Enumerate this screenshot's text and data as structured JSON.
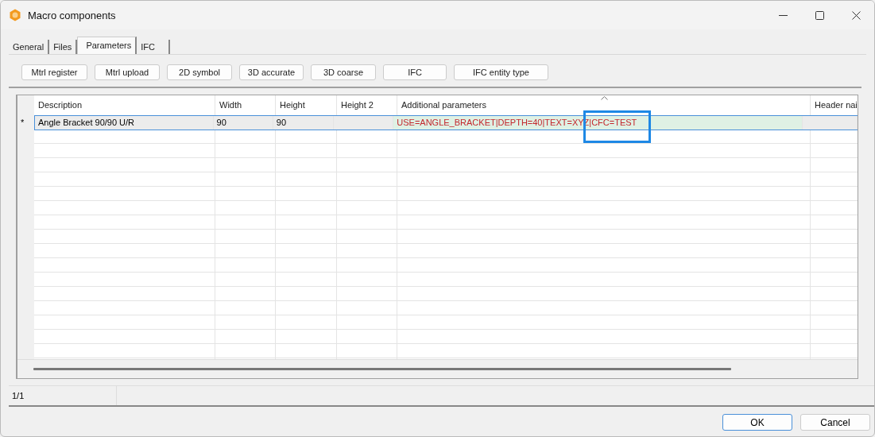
{
  "window": {
    "title": "Macro components"
  },
  "tabs": [
    {
      "label": "General",
      "selected": false
    },
    {
      "label": "Files",
      "selected": false
    },
    {
      "label": "Parameters",
      "selected": true
    },
    {
      "label": "IFC",
      "selected": false
    }
  ],
  "toolbar": [
    "Mtrl register",
    "Mtrl upload",
    "2D symbol",
    "3D accurate",
    "3D coarse",
    "IFC",
    "IFC entity type"
  ],
  "table": {
    "columns": [
      {
        "label": "Description",
        "sorted": false
      },
      {
        "label": "Width",
        "sorted": false
      },
      {
        "label": "Height",
        "sorted": false
      },
      {
        "label": "Height 2",
        "sorted": false
      },
      {
        "label": "Additional parameters",
        "sorted": true
      },
      {
        "label": "Header nai",
        "sorted": false
      }
    ],
    "rows": [
      {
        "marker": "*",
        "selected": true,
        "cells": [
          "Angle Bracket 90/90 U/R",
          "90",
          "90",
          "",
          "USE=ANGLE_BRACKET|DEPTH=40|TEXT=XYZ|CFC=TEST",
          ""
        ]
      }
    ],
    "highlight_box": true
  },
  "status_bar": [
    "1/1"
  ],
  "buttons": [
    {
      "label": "OK",
      "default": true
    },
    {
      "label": "Cancel",
      "default": false
    }
  ]
}
